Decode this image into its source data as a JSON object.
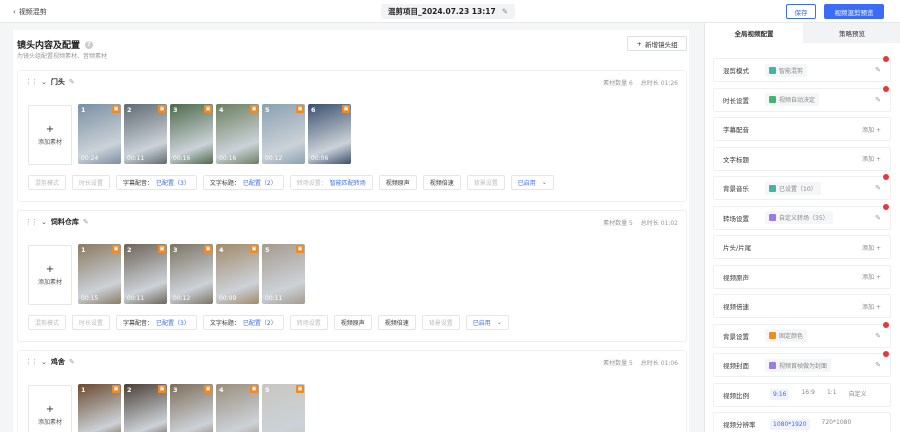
{
  "topbar": {
    "back_label": "视频混剪",
    "project_title": "混剪项目_2024.07.23 13:17",
    "save_label": "保存",
    "preview_label": "视频混剪预览"
  },
  "main": {
    "title": "镜头内容及配置",
    "subtitle": "为镜头组配置视频素材、音频素材",
    "add_group_label": "新增镜头组",
    "add_material_label": "添加素材",
    "groups": [
      {
        "name": "门头",
        "count_text": "素材数量 6",
        "duration_text": "总时长 01:26",
        "thumbs": [
          {
            "index": "1",
            "duration": "00:24",
            "color": "#7a8fa3"
          },
          {
            "index": "2",
            "duration": "00:11",
            "color": "#5f6a72"
          },
          {
            "index": "3",
            "duration": "00:16",
            "color": "#4c6a4a"
          },
          {
            "index": "4",
            "duration": "00:16",
            "color": "#6b7f5f"
          },
          {
            "index": "5",
            "duration": "00:12",
            "color": "#8aa0b1"
          },
          {
            "index": "6",
            "duration": "00:06",
            "color": "#3a4f6e"
          }
        ],
        "options": [
          {
            "label": "混剪模式",
            "value": "",
            "active": false
          },
          {
            "label": "时长设置",
            "value": "",
            "active": false
          },
          {
            "label": "字幕配音：",
            "value": "已配置（3）",
            "active": true
          },
          {
            "label": "文字标题：",
            "value": "已配置（2）",
            "active": true
          },
          {
            "label": "转场设置：",
            "value": "智能匹配转场",
            "active": false
          },
          {
            "label": "视频原声",
            "value": "",
            "active": true
          },
          {
            "label": "视频倍速",
            "value": "",
            "active": true
          },
          {
            "label": "背景设置",
            "value": "",
            "active": false
          }
        ],
        "enabled_label": "已启用"
      },
      {
        "name": "饲料仓库",
        "count_text": "素材数量 5",
        "duration_text": "总时长 01:02",
        "thumbs": [
          {
            "index": "1",
            "duration": "00:15",
            "color": "#8a7a62"
          },
          {
            "index": "2",
            "duration": "00:11",
            "color": "#6d6457"
          },
          {
            "index": "3",
            "duration": "00:12",
            "color": "#7c7463"
          },
          {
            "index": "4",
            "duration": "00:09",
            "color": "#a08a6a"
          },
          {
            "index": "5",
            "duration": "00:11",
            "color": "#a59a8c"
          }
        ],
        "options": [
          {
            "label": "混剪模式",
            "value": "",
            "active": false
          },
          {
            "label": "时长设置",
            "value": "",
            "active": false
          },
          {
            "label": "字幕配音：",
            "value": "已配置（3）",
            "active": true
          },
          {
            "label": "文字标题：",
            "value": "已配置（2）",
            "active": true
          },
          {
            "label": "转场设置",
            "value": "",
            "active": false
          },
          {
            "label": "视频原声",
            "value": "",
            "active": true
          },
          {
            "label": "视频倍速",
            "value": "",
            "active": true
          },
          {
            "label": "背景设置",
            "value": "",
            "active": false
          }
        ],
        "enabled_label": "已启用"
      },
      {
        "name": "鸡舍",
        "count_text": "素材数量 5",
        "duration_text": "总时长 01:06",
        "thumbs": [
          {
            "index": "1",
            "duration": "",
            "color": "#6b4a2e"
          },
          {
            "index": "2",
            "duration": "",
            "color": "#4a3f35"
          },
          {
            "index": "3",
            "duration": "",
            "color": "#7d6e5a"
          },
          {
            "index": "4",
            "duration": "",
            "color": "#9a8e7c"
          },
          {
            "index": "5",
            "duration": "",
            "color": "#c9c6c0"
          }
        ]
      }
    ]
  },
  "side": {
    "tabs": [
      "全局视频配置",
      "策略预览"
    ],
    "rows": [
      {
        "label": "混剪模式",
        "chip": "智能混剪",
        "chip_color": "#3fb6a8",
        "action": "edit",
        "dot": true
      },
      {
        "label": "时长设置",
        "chip": "视频自动决定",
        "chip_color": "#3fb672",
        "action": "edit",
        "dot": true
      },
      {
        "label": "字幕配音",
        "chip": "",
        "chip_color": "",
        "action": "添加",
        "dot": false
      },
      {
        "label": "文字标题",
        "chip": "",
        "chip_color": "",
        "action": "添加",
        "dot": false
      },
      {
        "label": "背景音乐",
        "chip": "已设置（10）",
        "chip_color": "#3fb6a8",
        "action": "edit",
        "dot": true
      },
      {
        "label": "转场设置",
        "chip": "自定义转场（35）",
        "chip_color": "#9a7ce6",
        "action": "edit",
        "dot": true
      },
      {
        "label": "片头/片尾",
        "chip": "",
        "chip_color": "",
        "action": "添加",
        "dot": false
      },
      {
        "label": "视频原声",
        "chip": "",
        "chip_color": "",
        "action": "添加",
        "dot": false
      },
      {
        "label": "视频倍速",
        "chip": "",
        "chip_color": "",
        "action": "添加",
        "dot": false
      },
      {
        "label": "背景设置",
        "chip": "固定颜色",
        "chip_color": "#f08a24",
        "action": "edit",
        "dot": true
      },
      {
        "label": "视频封面",
        "chip": "视频首帧做为封面",
        "chip_color": "#9a7ce6",
        "action": "edit",
        "dot": true
      }
    ],
    "ratio": {
      "label": "视频比例",
      "options": [
        "9:16",
        "16:9",
        "1:1",
        "自定义"
      ],
      "selected": "9:16"
    },
    "resolution": {
      "label": "视频分辨率",
      "options": [
        "1080*1920",
        "720*1080"
      ],
      "selected": "1080*1920"
    }
  }
}
